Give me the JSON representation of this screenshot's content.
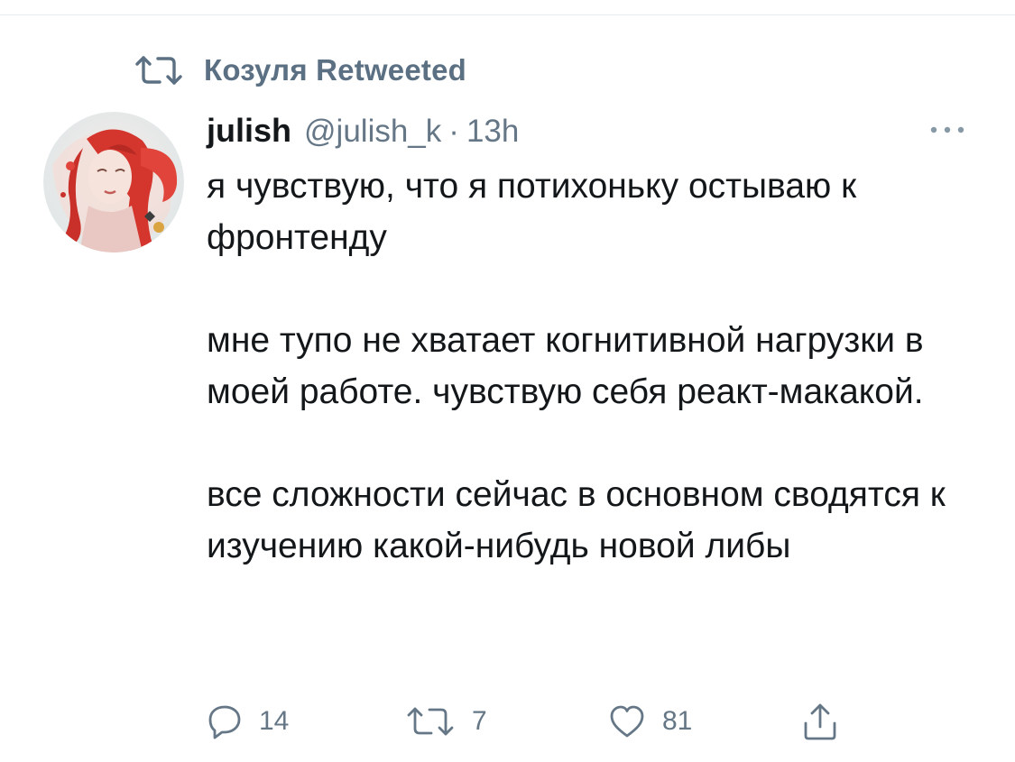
{
  "retweet": {
    "icon": "retweet-icon",
    "label": "Козуля Retweeted"
  },
  "tweet": {
    "author": {
      "name": "julish",
      "handle": "@julish_k",
      "separator": "·",
      "time": "13h",
      "avatar_icon": "avatar-illustration"
    },
    "more_icon": "more-horizontal-icon",
    "paragraphs": [
      "я чувствую, что я потихоньку остываю к фронтенду",
      "мне тупо не хватает когнитивной нагрузки в моей работе. чувствую себя реакт-макакой.",
      "все сложности сейчас в основном сводятся к изучению какой-нибудь новой либы"
    ]
  },
  "actions": {
    "reply": {
      "icon": "reply-icon",
      "count": "14"
    },
    "retweet": {
      "icon": "retweet-icon",
      "count": "7"
    },
    "like": {
      "icon": "heart-icon",
      "count": "81"
    },
    "share": {
      "icon": "share-icon"
    }
  },
  "colors": {
    "text": "#14171a",
    "secondary": "#657786",
    "retweet_label": "#5b7083",
    "divider": "#e6ecf0",
    "background": "#ffffff"
  }
}
